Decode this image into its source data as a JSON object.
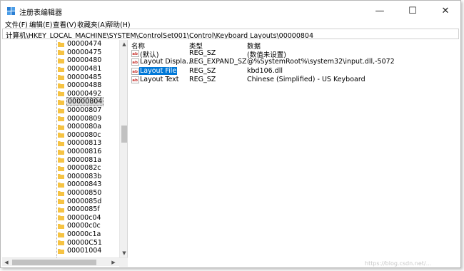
{
  "window": {
    "title": "注册表编辑器",
    "controls": {
      "minimize": "—",
      "maximize": "☐",
      "close": "✕"
    }
  },
  "menu": [
    "文件(F)",
    "编辑(E)",
    "查看(V)",
    "收藏夹(A)",
    "帮助(H)"
  ],
  "address": "计算机\\HKEY_LOCAL_MACHINE\\SYSTEM\\ControlSet001\\Control\\Keyboard Layouts\\00000804",
  "tree": {
    "items": [
      "00000474",
      "00000475",
      "00000480",
      "00000481",
      "00000485",
      "00000488",
      "00000492",
      "00000804",
      "00000807",
      "00000809",
      "0000080a",
      "0000080c",
      "00000813",
      "00000816",
      "0000081a",
      "0000082c",
      "0000083b",
      "00000843",
      "00000850",
      "0000085d",
      "0000085f",
      "00000c04",
      "00000c0c",
      "00000c1a",
      "00000C51",
      "00001004"
    ],
    "selected_index": 7
  },
  "list": {
    "columns": [
      "名称",
      "类型",
      "数据"
    ],
    "rows": [
      {
        "icon": "string-value-icon",
        "name": "(默认)",
        "type": "REG_SZ",
        "data": "(数值未设置)"
      },
      {
        "icon": "string-value-icon",
        "name": "Layout Display ...",
        "type": "REG_EXPAND_SZ",
        "data": "@%SystemRoot%\\system32\\input.dll,-5072"
      },
      {
        "icon": "string-value-icon",
        "name": "Layout File",
        "type": "REG_SZ",
        "data": "kbd106.dll",
        "selected": true
      },
      {
        "icon": "string-value-icon",
        "name": "Layout Text",
        "type": "REG_SZ",
        "data": "Chinese (Simplified) - US Keyboard"
      }
    ]
  },
  "colors": {
    "selection": "#0078d7",
    "folder": "#f6c343",
    "value_icon_red": "#c8312c"
  }
}
